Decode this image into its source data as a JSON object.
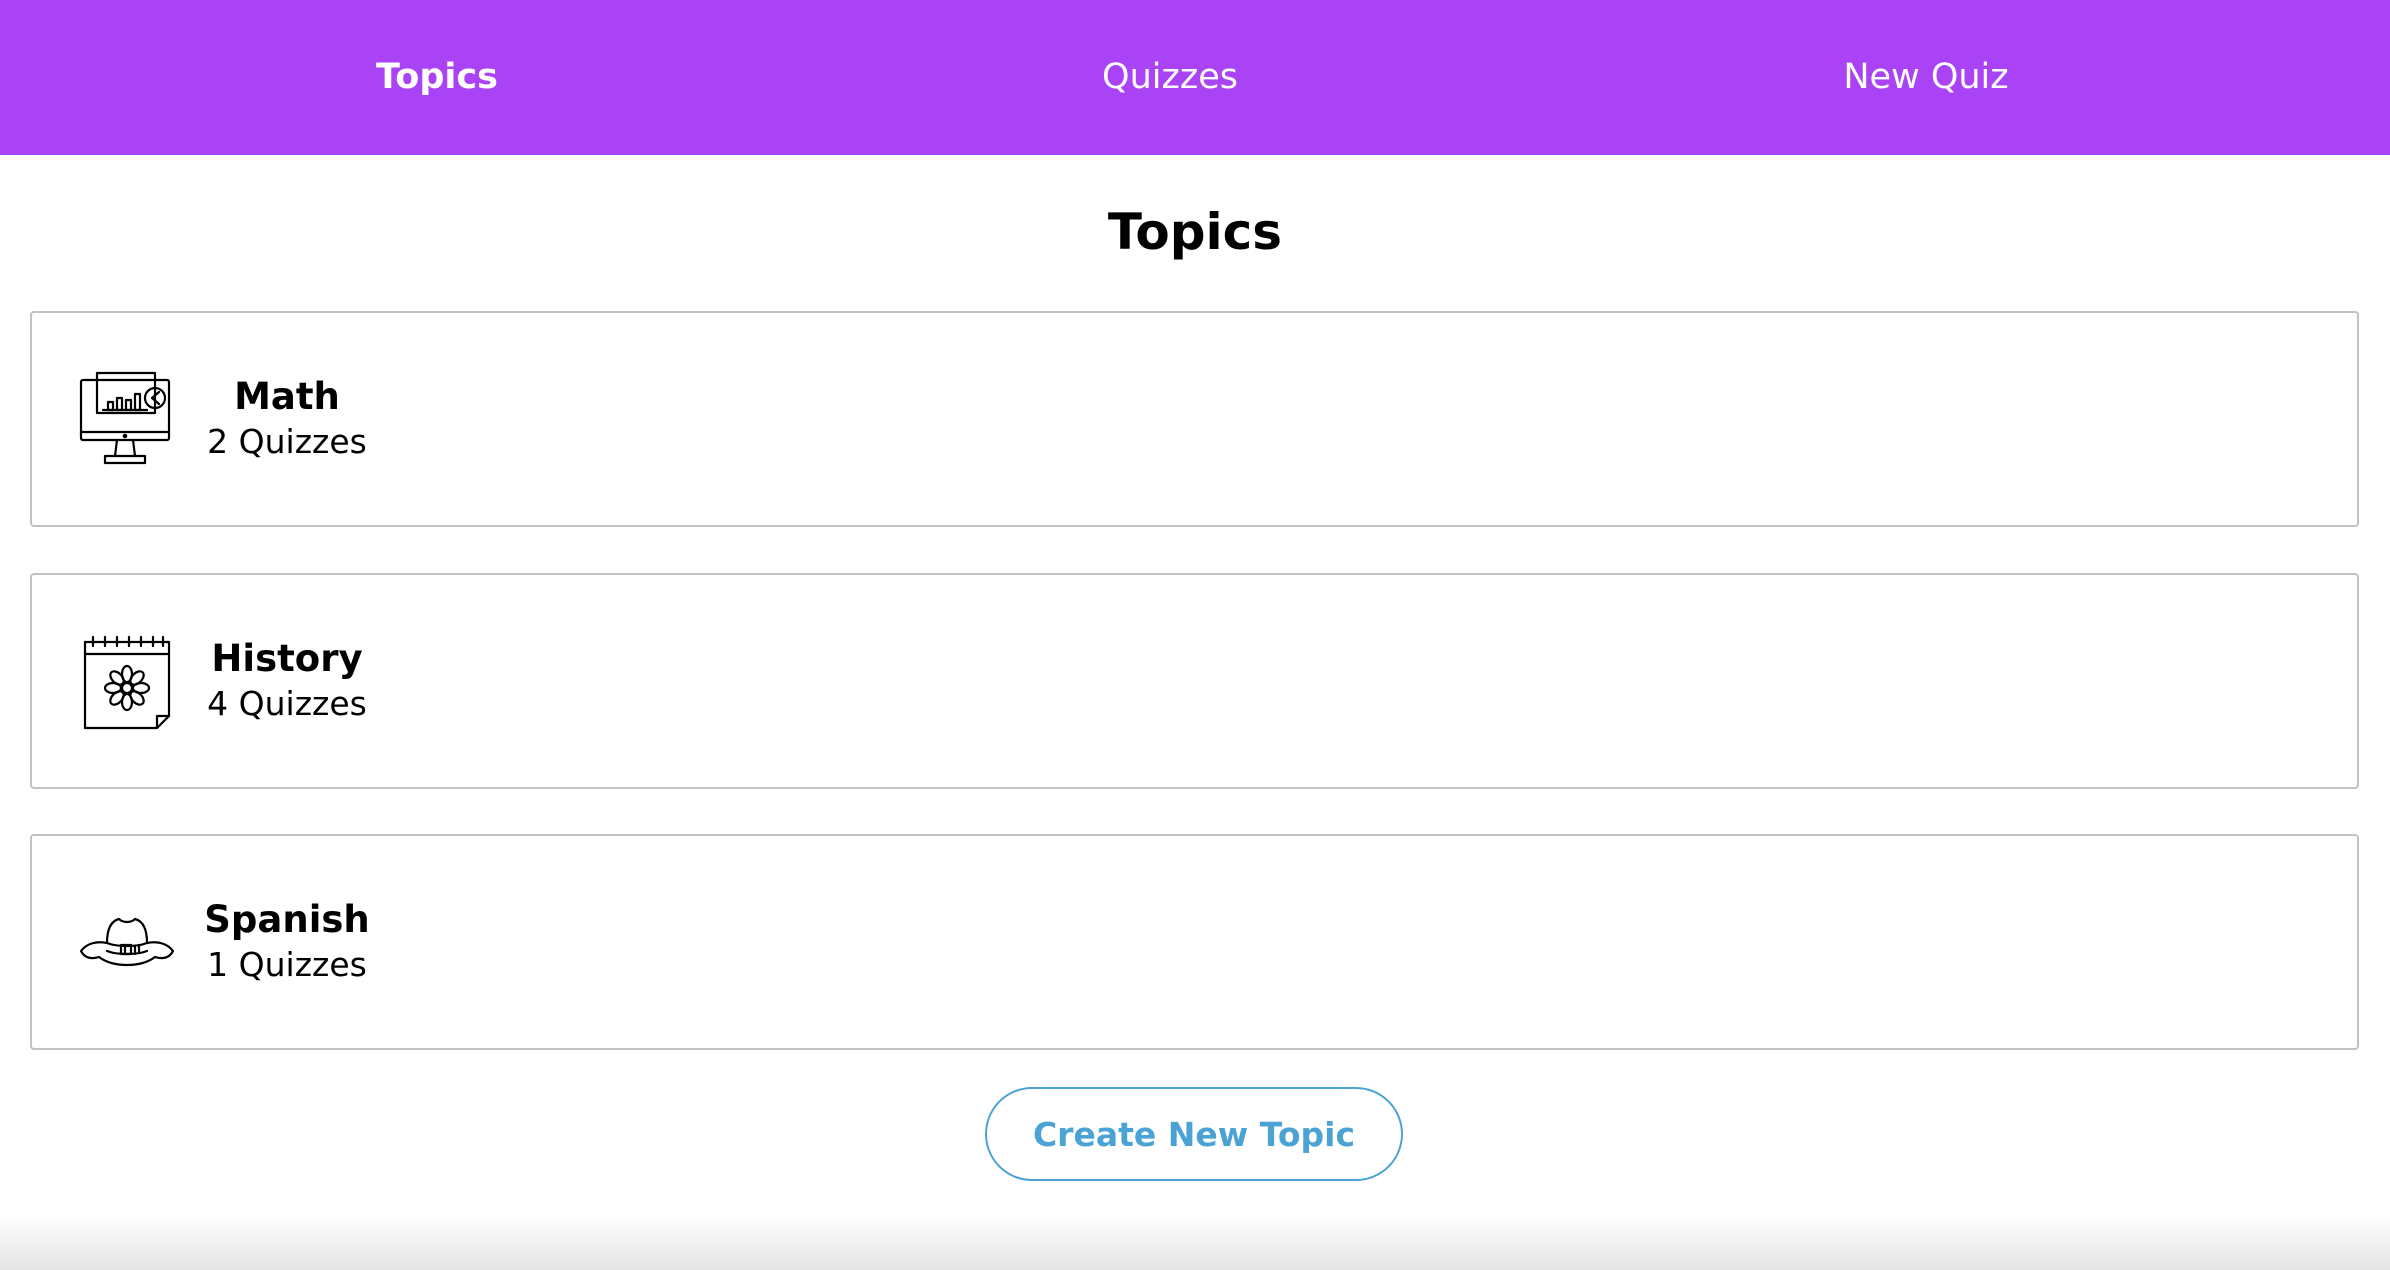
{
  "nav": {
    "items": [
      {
        "label": "Topics",
        "active": true
      },
      {
        "label": "Quizzes",
        "active": false
      },
      {
        "label": "New Quiz",
        "active": false
      }
    ],
    "background_color": "#aa43f5"
  },
  "page": {
    "title": "Topics"
  },
  "topics": [
    {
      "name": "Math",
      "count_label": "2 Quizzes",
      "icon": "computer-chart-icon"
    },
    {
      "name": "History",
      "count_label": "4 Quizzes",
      "icon": "calendar-flower-icon"
    },
    {
      "name": "Spanish",
      "count_label": "1 Quizzes",
      "icon": "sombrero-hat-icon"
    }
  ],
  "actions": {
    "create_topic_label": "Create New Topic",
    "accent_color": "#4aa3d4"
  }
}
